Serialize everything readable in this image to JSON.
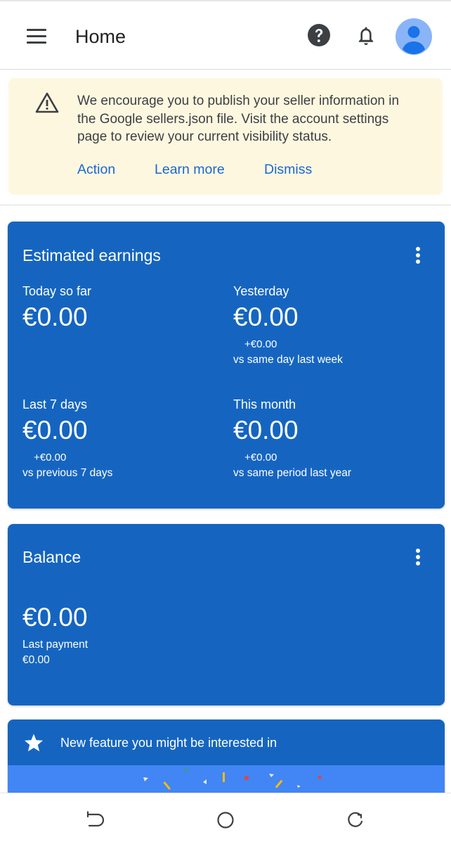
{
  "appbar": {
    "title": "Home",
    "menu_icon": "menu-icon",
    "help_icon": "help-icon",
    "notifications_icon": "bell-icon",
    "avatar_icon": "account-avatar-icon"
  },
  "banner": {
    "icon": "warning-icon",
    "message": "We encourage you to publish your seller information in the Google sellers.json file. Visit the account settings page to review your current visibility status.",
    "actions": [
      "Action",
      "Learn more",
      "Dismiss"
    ]
  },
  "earnings": {
    "title": "Estimated earnings",
    "metrics": [
      {
        "label": "Today so far",
        "value": "€0.00",
        "delta": "",
        "compare": ""
      },
      {
        "label": "Yesterday",
        "value": "€0.00",
        "delta": "+€0.00",
        "compare": "vs same day last week"
      },
      {
        "label": "Last 7 days",
        "value": "€0.00",
        "delta": "+€0.00",
        "compare": "vs previous 7 days"
      },
      {
        "label": "This month",
        "value": "€0.00",
        "delta": "+€0.00",
        "compare": "vs same period last year"
      }
    ]
  },
  "balance": {
    "title": "Balance",
    "value": "€0.00",
    "last_payment_label": "Last payment",
    "last_payment_value": "€0.00"
  },
  "feature": {
    "icon": "star-icon",
    "text": "New feature you might be interested in"
  },
  "colors": {
    "card_blue": "#1565c0",
    "banner_bg": "#fef7e0",
    "link_blue": "#1967d2",
    "feature_banner": "#4285f4"
  },
  "navbar": {
    "back_icon": "back-icon",
    "home_icon": "home-circle-icon",
    "recent_icon": "recent-apps-icon"
  }
}
